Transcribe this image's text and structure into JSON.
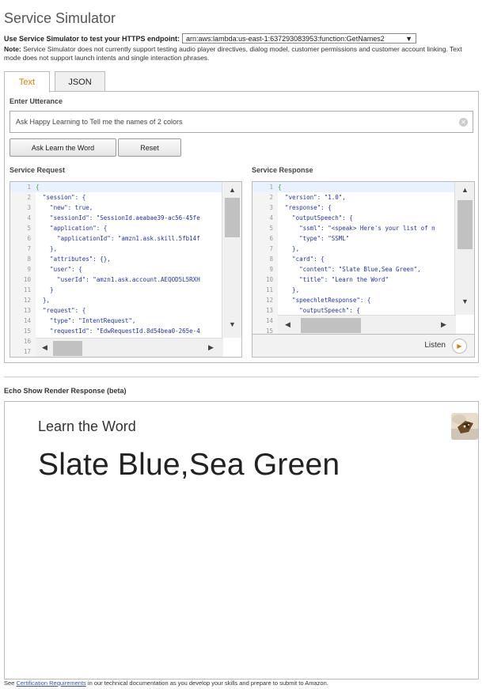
{
  "page": {
    "title": "Service Simulator"
  },
  "endpoint": {
    "label": "Use Service Simulator to test your HTTPS endpoint:",
    "value": "arn:aws:lambda:us-east-1:637293083953:function:GetNames2"
  },
  "note": {
    "prefix": "Note:",
    "text": " Service Simulator does not currently support testing audio player directives, dialog model, customer permissions and customer account linking. Text mode does not support launch intents and single interaction phrases."
  },
  "tabs": [
    {
      "label": "Text",
      "active": true
    },
    {
      "label": "JSON",
      "active": false
    }
  ],
  "utterance": {
    "label": "Enter Utterance",
    "value": "Ask Happy Learning to Tell me the names of 2 colors"
  },
  "buttons": {
    "ask": "Ask Learn the Word",
    "reset": "Reset"
  },
  "request": {
    "label": "Service Request",
    "lines": [
      {
        "n": "1",
        "t": "{"
      },
      {
        "n": "2",
        "t": "  \"session\": {"
      },
      {
        "n": "3",
        "t": "    \"new\": true,"
      },
      {
        "n": "4",
        "t": "    \"sessionId\": \"SessionId.aeabae39-ac56-45fe"
      },
      {
        "n": "5",
        "t": "    \"application\": {"
      },
      {
        "n": "6",
        "t": "      \"applicationId\": \"amzn1.ask.skill.5fb14f"
      },
      {
        "n": "7",
        "t": "    },"
      },
      {
        "n": "8",
        "t": "    \"attributes\": {},"
      },
      {
        "n": "9",
        "t": "    \"user\": {"
      },
      {
        "n": "10",
        "t": "      \"userId\": \"amzn1.ask.account.AEQOD5L5RXH"
      },
      {
        "n": "11",
        "t": "    }"
      },
      {
        "n": "12",
        "t": "  },"
      },
      {
        "n": "13",
        "t": "  \"request\": {"
      },
      {
        "n": "14",
        "t": "    \"type\": \"IntentRequest\","
      },
      {
        "n": "15",
        "t": "    \"requestId\": \"EdwRequestId.8d54bea0-265e-4"
      },
      {
        "n": "16",
        "t": ""
      },
      {
        "n": "17",
        "t": ""
      }
    ]
  },
  "response": {
    "label": "Service Response",
    "lines": [
      {
        "n": "1",
        "t": "{"
      },
      {
        "n": "2",
        "t": "  \"version\": \"1.0\","
      },
      {
        "n": "3",
        "t": "  \"response\": {"
      },
      {
        "n": "4",
        "t": "    \"outputSpeech\": {"
      },
      {
        "n": "5",
        "t": "      \"ssml\": \"<speak> Here's your list of n"
      },
      {
        "n": "6",
        "t": "      \"type\": \"SSML\""
      },
      {
        "n": "7",
        "t": "    },"
      },
      {
        "n": "8",
        "t": "    \"card\": {"
      },
      {
        "n": "9",
        "t": "      \"content\": \"Slate Blue,Sea Green\","
      },
      {
        "n": "10",
        "t": "      \"title\": \"Learn the Word\""
      },
      {
        "n": "11",
        "t": "    },"
      },
      {
        "n": "12",
        "t": "    \"speechletResponse\": {"
      },
      {
        "n": "13",
        "t": "      \"outputSpeech\": {"
      },
      {
        "n": "14",
        "t": ""
      },
      {
        "n": "15",
        "t": ""
      }
    ],
    "listen_label": "Listen"
  },
  "echo": {
    "label": "Echo Show Render Response (beta)",
    "title": "Learn the Word",
    "content": "Slate Blue,Sea Green"
  },
  "footer": {
    "prefix": "See ",
    "link": "Certification Requirements",
    "suffix": " in our technical documentation as you develop your skills and prepare to submit to Amazon."
  },
  "icons": {
    "clear": "clear-circle-icon",
    "play": "play-icon",
    "dropdown": "dropdown-arrow-icon"
  },
  "colors": {
    "accent": "#e07b00",
    "link": "#3355aa",
    "code": "#2233aa"
  }
}
